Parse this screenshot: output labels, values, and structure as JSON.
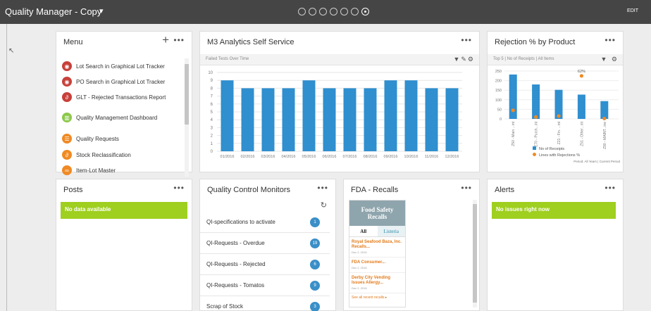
{
  "app": {
    "title": "Quality Manager - Copy",
    "caret": "▾",
    "edit": "EDIT",
    "page_dots": 7,
    "active_dot": 7
  },
  "menu": {
    "title": "Menu",
    "add": "+",
    "more": "•••",
    "items": [
      {
        "label": "Lot Search in Graphical Lot Tracker",
        "color": "#c8403a",
        "icon": "globe-icon"
      },
      {
        "label": "PO Search in Graphical Lot Tracker",
        "color": "#c8403a",
        "icon": "globe-icon"
      },
      {
        "label": "GLT - Rejected Transactions Report",
        "color": "#c8403a",
        "icon": "link-icon"
      },
      {
        "label": "Quality Management Dashboard",
        "color": "#8cc84b",
        "icon": "dashboard-icon"
      },
      {
        "label": "Quality Requests",
        "color": "#f08a24",
        "icon": "list-icon"
      },
      {
        "label": "Stock Reclassification",
        "color": "#f08a24",
        "icon": "link-icon"
      },
      {
        "label": "Item-Lot Master",
        "color": "#f08a24",
        "icon": "link-icon"
      }
    ]
  },
  "analytics": {
    "title": "M3 Analytics Self Service",
    "more": "•••",
    "subtitle": "Failed Tests Over Time",
    "tools": "▼✎⚙"
  },
  "rejection": {
    "title": "Rejection % by Product",
    "more": "•••",
    "subtitle": "Top 5 | No of Receipts | All Items",
    "tools": "▼ ⚙",
    "legend_receipts": "No of Receipts",
    "legend_lines": "Lines with Rejections %",
    "footer": "Period: All Years | Current Period"
  },
  "posts": {
    "title": "Posts",
    "more": "•••",
    "banner": "No data available"
  },
  "qc": {
    "title": "Quality Control Monitors",
    "more": "•••",
    "refresh": "↻",
    "rows": [
      {
        "label": "QI-specifications to activate",
        "count": "1"
      },
      {
        "label": "QI-Requests - Overdue",
        "count": "19"
      },
      {
        "label": "QI-Requests - Rejected",
        "count": "6"
      },
      {
        "label": "QI-Requests - Tomatos",
        "count": "9"
      },
      {
        "label": "Scrap of Stock",
        "count": "3"
      }
    ]
  },
  "fda": {
    "title": "FDA - Recalls",
    "more": "•••",
    "widget_title_1": "Food Safety",
    "widget_title_2": "Recalls",
    "tab_all": "All",
    "tab_listeria": "Listeria",
    "items": [
      {
        "title": "Royal Seafood Baza, Inc. Recalls...",
        "date": "Dec 2, 2016"
      },
      {
        "title": "FDA Consumer...",
        "date": "Dec 2, 2016"
      },
      {
        "title": "Derby City Vending Issues Allergy...",
        "date": "Dec 2, 2016"
      }
    ],
    "see_all": "See all recent recalls ▸"
  },
  "alerts": {
    "title": "Alerts",
    "more": "•••",
    "banner": "No issues right now"
  },
  "chart_data": [
    {
      "type": "bar",
      "title": "Failed Tests Over Time",
      "categories": [
        "01/2016",
        "02/2016",
        "03/2016",
        "04/2016",
        "05/2016",
        "06/2016",
        "07/2016",
        "08/2016",
        "09/2016",
        "10/2016",
        "11/2016",
        "12/2016"
      ],
      "values": [
        9,
        8,
        8,
        8,
        9,
        8,
        8,
        8,
        9,
        9,
        8,
        8
      ],
      "ylim": [
        0,
        10
      ],
      "yticks": [
        0,
        1,
        2,
        3,
        4,
        5,
        6,
        7,
        8,
        9,
        10
      ],
      "color": "#2f8fcf",
      "grid": true
    },
    {
      "type": "bar",
      "title": "Rejection % by Product",
      "categories": [
        "Z50 - Main ...int",
        "Z70 - Purch...int",
        "Z21 - Fin. ...int",
        "Z51 - Other...int",
        "Z90 - MAINT...ine"
      ],
      "series": [
        {
          "name": "No of Receipts",
          "values": [
            232,
            180,
            152,
            127,
            93
          ],
          "color": "#2f8fcf"
        },
        {
          "name": "Lines with Rejections %",
          "values": [
            45,
            10,
            15,
            225,
            2
          ],
          "color": "#f08a24",
          "kind": "point"
        }
      ],
      "point_labels": [
        "",
        "",
        "",
        "62%",
        ""
      ],
      "ylim": [
        0,
        250
      ],
      "yticks": [
        0,
        50,
        100,
        150,
        200,
        250
      ],
      "legend": "bottom"
    }
  ]
}
